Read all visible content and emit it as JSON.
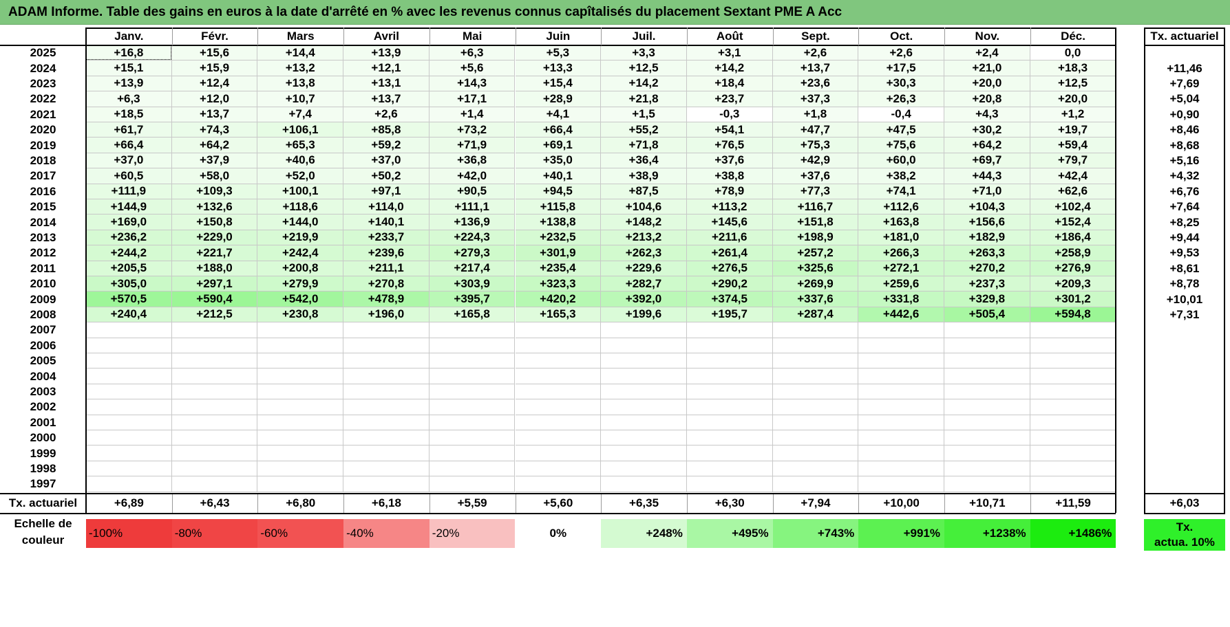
{
  "title": "ADAM Informe. Table des gains en euros à la date d'arrêté en % avec les revenus connus capîtalisés du placement Sextant PME A Acc",
  "months": [
    "Janv.",
    "Févr.",
    "Mars",
    "Avril",
    "Mai",
    "Juin",
    "Juil.",
    "Août",
    "Sept.",
    "Oct.",
    "Nov.",
    "Déc."
  ],
  "tx_header": "Tx. actuariel",
  "rows": [
    {
      "year": "2025",
      "values": [
        "+16,8",
        "+15,6",
        "+14,4",
        "+13,9",
        "+6,3",
        "+5,3",
        "+3,3",
        "+3,1",
        "+2,6",
        "+2,6",
        "+2,4",
        "0,0"
      ],
      "tx": ""
    },
    {
      "year": "2024",
      "values": [
        "+15,1",
        "+15,9",
        "+13,2",
        "+12,1",
        "+5,6",
        "+13,3",
        "+12,5",
        "+14,2",
        "+13,7",
        "+17,5",
        "+21,0",
        "+18,3"
      ],
      "tx": "+11,46"
    },
    {
      "year": "2023",
      "values": [
        "+13,9",
        "+12,4",
        "+13,8",
        "+13,1",
        "+14,3",
        "+15,4",
        "+14,2",
        "+18,4",
        "+23,6",
        "+30,3",
        "+20,0",
        "+12,5"
      ],
      "tx": "+7,69"
    },
    {
      "year": "2022",
      "values": [
        "+6,3",
        "+12,0",
        "+10,7",
        "+13,7",
        "+17,1",
        "+28,9",
        "+21,8",
        "+23,7",
        "+37,3",
        "+26,3",
        "+20,8",
        "+20,0"
      ],
      "tx": "+5,04"
    },
    {
      "year": "2021",
      "values": [
        "+18,5",
        "+13,7",
        "+7,4",
        "+2,6",
        "+1,4",
        "+4,1",
        "+1,5",
        "-0,3",
        "+1,8",
        "-0,4",
        "+4,3",
        "+1,2"
      ],
      "tx": "+0,90"
    },
    {
      "year": "2020",
      "values": [
        "+61,7",
        "+74,3",
        "+106,1",
        "+85,8",
        "+73,2",
        "+66,4",
        "+55,2",
        "+54,1",
        "+47,7",
        "+47,5",
        "+30,2",
        "+19,7"
      ],
      "tx": "+8,46"
    },
    {
      "year": "2019",
      "values": [
        "+66,4",
        "+64,2",
        "+65,3",
        "+59,2",
        "+71,9",
        "+69,1",
        "+71,8",
        "+76,5",
        "+75,3",
        "+75,6",
        "+64,2",
        "+59,4"
      ],
      "tx": "+8,68"
    },
    {
      "year": "2018",
      "values": [
        "+37,0",
        "+37,9",
        "+40,6",
        "+37,0",
        "+36,8",
        "+35,0",
        "+36,4",
        "+37,6",
        "+42,9",
        "+60,0",
        "+69,7",
        "+79,7"
      ],
      "tx": "+5,16"
    },
    {
      "year": "2017",
      "values": [
        "+60,5",
        "+58,0",
        "+52,0",
        "+50,2",
        "+42,0",
        "+40,1",
        "+38,9",
        "+38,8",
        "+37,6",
        "+38,2",
        "+44,3",
        "+42,4"
      ],
      "tx": "+4,32"
    },
    {
      "year": "2016",
      "values": [
        "+111,9",
        "+109,3",
        "+100,1",
        "+97,1",
        "+90,5",
        "+94,5",
        "+87,5",
        "+78,9",
        "+77,3",
        "+74,1",
        "+71,0",
        "+62,6"
      ],
      "tx": "+6,76"
    },
    {
      "year": "2015",
      "values": [
        "+144,9",
        "+132,6",
        "+118,6",
        "+114,0",
        "+111,1",
        "+115,8",
        "+104,6",
        "+113,2",
        "+116,7",
        "+112,6",
        "+104,3",
        "+102,4"
      ],
      "tx": "+7,64"
    },
    {
      "year": "2014",
      "values": [
        "+169,0",
        "+150,8",
        "+144,0",
        "+140,1",
        "+136,9",
        "+138,8",
        "+148,2",
        "+145,6",
        "+151,8",
        "+163,8",
        "+156,6",
        "+152,4"
      ],
      "tx": "+8,25"
    },
    {
      "year": "2013",
      "values": [
        "+236,2",
        "+229,0",
        "+219,9",
        "+233,7",
        "+224,3",
        "+232,5",
        "+213,2",
        "+211,6",
        "+198,9",
        "+181,0",
        "+182,9",
        "+186,4"
      ],
      "tx": "+9,44"
    },
    {
      "year": "2012",
      "values": [
        "+244,2",
        "+221,7",
        "+242,4",
        "+239,6",
        "+279,3",
        "+301,9",
        "+262,3",
        "+261,4",
        "+257,2",
        "+266,3",
        "+263,3",
        "+258,9"
      ],
      "tx": "+9,53"
    },
    {
      "year": "2011",
      "values": [
        "+205,5",
        "+188,0",
        "+200,8",
        "+211,1",
        "+217,4",
        "+235,4",
        "+229,6",
        "+276,5",
        "+325,6",
        "+272,1",
        "+270,2",
        "+276,9"
      ],
      "tx": "+8,61"
    },
    {
      "year": "2010",
      "values": [
        "+305,0",
        "+297,1",
        "+279,9",
        "+270,8",
        "+303,9",
        "+323,3",
        "+282,7",
        "+290,2",
        "+269,9",
        "+259,6",
        "+237,3",
        "+209,3"
      ],
      "tx": "+8,78"
    },
    {
      "year": "2009",
      "values": [
        "+570,5",
        "+590,4",
        "+542,0",
        "+478,9",
        "+395,7",
        "+420,2",
        "+392,0",
        "+374,5",
        "+337,6",
        "+331,8",
        "+329,8",
        "+301,2"
      ],
      "tx": "+10,01"
    },
    {
      "year": "2008",
      "values": [
        "+240,4",
        "+212,5",
        "+230,8",
        "+196,0",
        "+165,8",
        "+165,3",
        "+199,6",
        "+195,7",
        "+287,4",
        "+442,6",
        "+505,4",
        "+594,8"
      ],
      "tx": "+7,31"
    },
    {
      "year": "2007",
      "values": [
        "",
        "",
        "",
        "",
        "",
        "",
        "",
        "",
        "",
        "",
        "",
        ""
      ],
      "tx": ""
    },
    {
      "year": "2006",
      "values": [
        "",
        "",
        "",
        "",
        "",
        "",
        "",
        "",
        "",
        "",
        "",
        ""
      ],
      "tx": ""
    },
    {
      "year": "2005",
      "values": [
        "",
        "",
        "",
        "",
        "",
        "",
        "",
        "",
        "",
        "",
        "",
        ""
      ],
      "tx": ""
    },
    {
      "year": "2004",
      "values": [
        "",
        "",
        "",
        "",
        "",
        "",
        "",
        "",
        "",
        "",
        "",
        ""
      ],
      "tx": ""
    },
    {
      "year": "2003",
      "values": [
        "",
        "",
        "",
        "",
        "",
        "",
        "",
        "",
        "",
        "",
        "",
        ""
      ],
      "tx": ""
    },
    {
      "year": "2002",
      "values": [
        "",
        "",
        "",
        "",
        "",
        "",
        "",
        "",
        "",
        "",
        "",
        ""
      ],
      "tx": ""
    },
    {
      "year": "2001",
      "values": [
        "",
        "",
        "",
        "",
        "",
        "",
        "",
        "",
        "",
        "",
        "",
        ""
      ],
      "tx": ""
    },
    {
      "year": "2000",
      "values": [
        "",
        "",
        "",
        "",
        "",
        "",
        "",
        "",
        "",
        "",
        "",
        ""
      ],
      "tx": ""
    },
    {
      "year": "1999",
      "values": [
        "",
        "",
        "",
        "",
        "",
        "",
        "",
        "",
        "",
        "",
        "",
        ""
      ],
      "tx": ""
    },
    {
      "year": "1998",
      "values": [
        "",
        "",
        "",
        "",
        "",
        "",
        "",
        "",
        "",
        "",
        "",
        ""
      ],
      "tx": ""
    },
    {
      "year": "1997",
      "values": [
        "",
        "",
        "",
        "",
        "",
        "",
        "",
        "",
        "",
        "",
        "",
        ""
      ],
      "tx": ""
    }
  ],
  "footer": {
    "label": "Tx. actuariel",
    "values": [
      "+6,89",
      "+6,43",
      "+6,80",
      "+6,18",
      "+5,59",
      "+5,60",
      "+6,35",
      "+6,30",
      "+7,94",
      "+10,00",
      "+10,71",
      "+11,59"
    ],
    "tx": "+6,03"
  },
  "scale": {
    "label_line1": "Echelle de",
    "label_line2": "couleur",
    "items": [
      {
        "text": "-100%",
        "color": "#ee3b3b"
      },
      {
        "text": "-80%",
        "color": "#f04545"
      },
      {
        "text": "-60%",
        "color": "#f25252"
      },
      {
        "text": "-40%",
        "color": "#f68686"
      },
      {
        "text": "-20%",
        "color": "#f9c0c0"
      },
      {
        "text": "0%",
        "color": "#ffffff"
      },
      {
        "text": "+248%",
        "color": "#d4fad1"
      },
      {
        "text": "+495%",
        "color": "#a9f7a4"
      },
      {
        "text": "+743%",
        "color": "#86f47f"
      },
      {
        "text": "+991%",
        "color": "#5cf151"
      },
      {
        "text": "+1238%",
        "color": "#45ef3a"
      },
      {
        "text": "+1486%",
        "color": "#1cec0f"
      }
    ],
    "tx_line1": "Tx.",
    "tx_line2": "actua. 10%",
    "tx_color": "#2ff02a"
  },
  "colors": {
    "title_bar": "#80c67e",
    "grid": "#c8c8c8"
  }
}
